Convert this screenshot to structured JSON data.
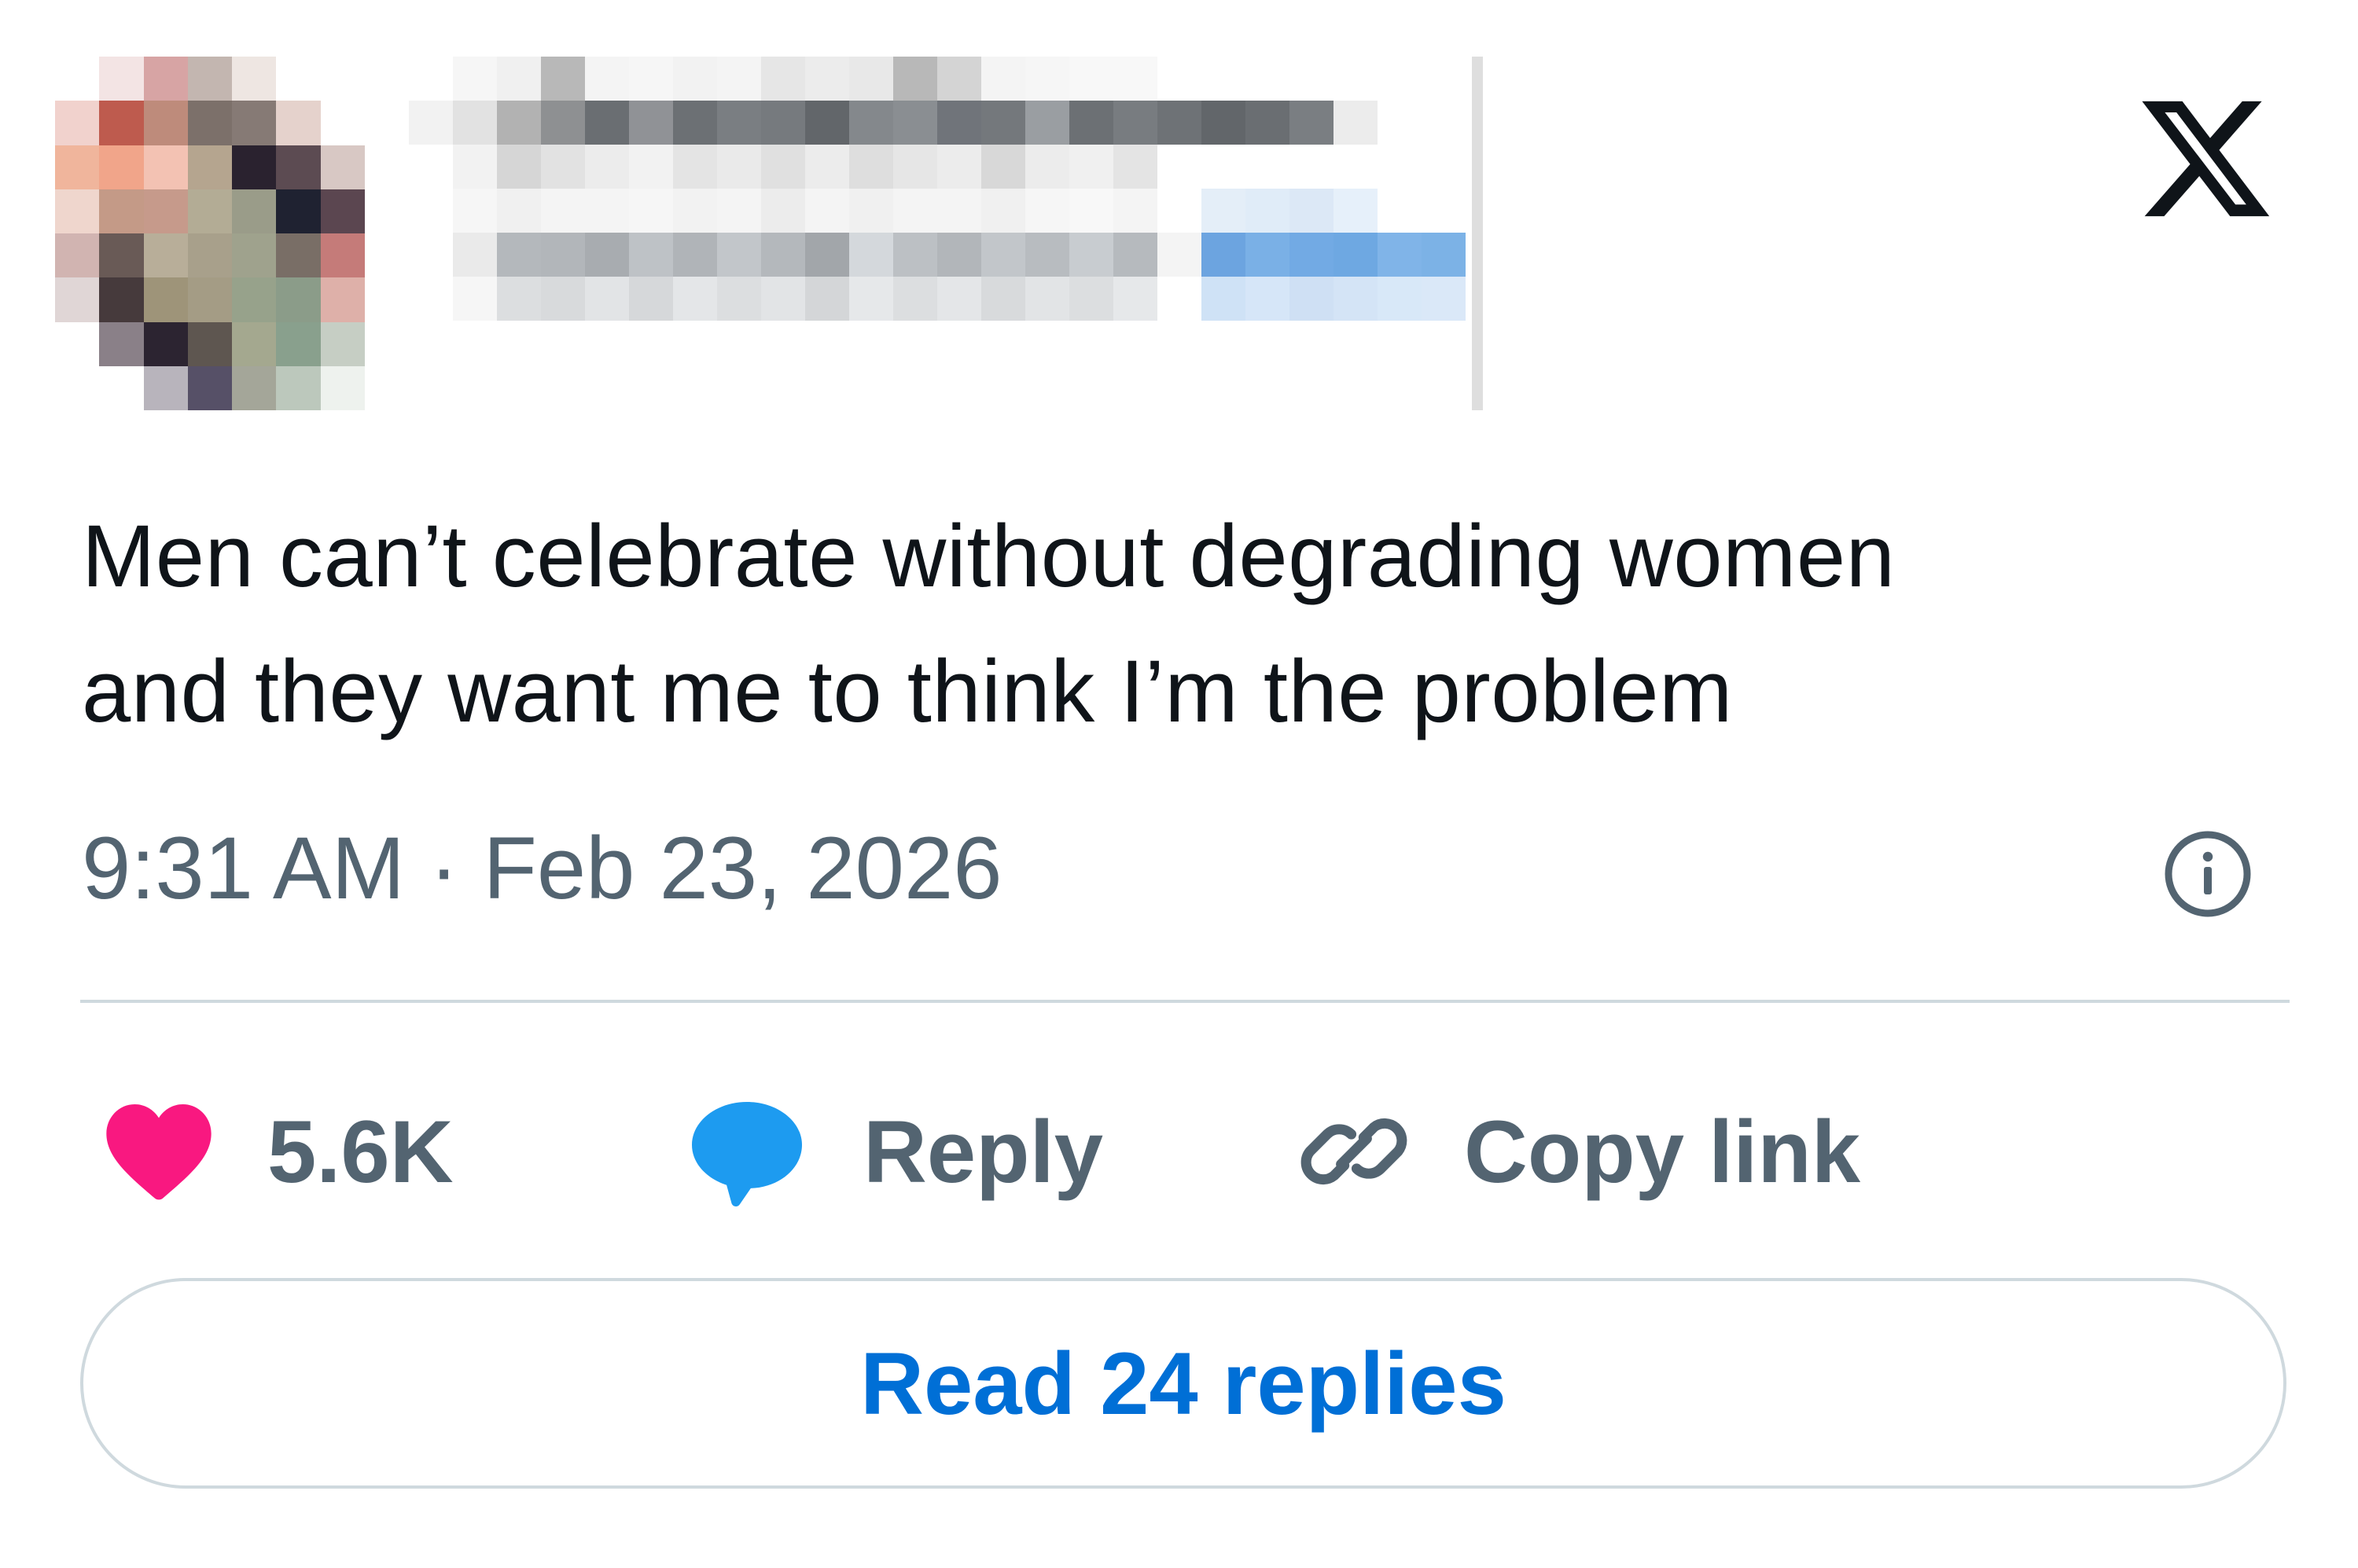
{
  "brand": {
    "logo_icon": "x-logo-icon",
    "logo_color": "#0f1419"
  },
  "author": {
    "avatar_icon": "avatar-pixelated",
    "name_redacted": true,
    "handle_redacted": true
  },
  "tweet": {
    "text_lines": [
      "Men can’t celebrate without degrading women",
      "and they want me to think I’m the problem"
    ],
    "timestamp": "9:31 AM · Feb 23, 2026",
    "info_icon": "info-icon"
  },
  "actions": {
    "like": {
      "icon": "heart-icon",
      "label": "5.6K",
      "color": "#f91880"
    },
    "reply": {
      "icon": "speech-bubble-icon",
      "label": "Reply",
      "color": "#1d9bf0"
    },
    "copy_link": {
      "icon": "link-icon",
      "label": "Copy link"
    }
  },
  "read_replies": {
    "label": "Read 24 replies",
    "color": "#006fd6"
  },
  "colors": {
    "text_primary": "#0f1419",
    "text_secondary": "#536471",
    "border": "#cfd9de"
  }
}
